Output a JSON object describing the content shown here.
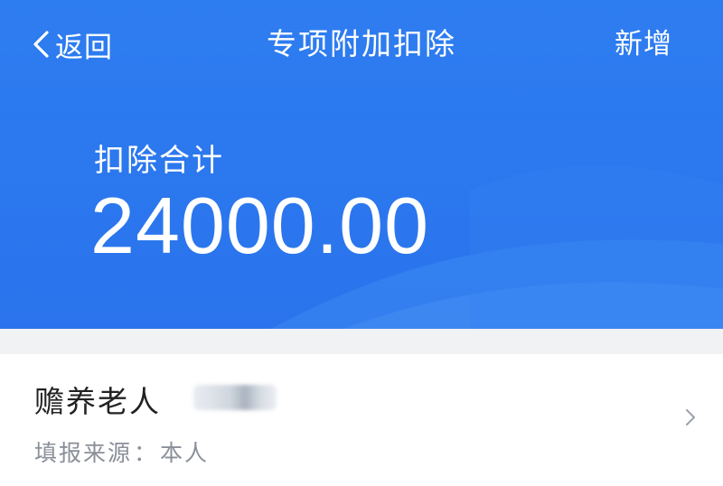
{
  "nav": {
    "back_label": "返回",
    "title": "专项附加扣除",
    "add_label": "新增"
  },
  "summary": {
    "label": "扣除合计",
    "amount": "24000.00"
  },
  "items": [
    {
      "title": "赡养老人",
      "source_label": "填报来源",
      "source_sep": "：",
      "source_value": "本人"
    }
  ],
  "colors": {
    "header_blue": "#2b77ee",
    "text_dark": "#222222",
    "text_muted": "#8a8f99"
  },
  "icons": {
    "back": "chevron-left-icon",
    "item_arrow": "chevron-right-icon"
  }
}
